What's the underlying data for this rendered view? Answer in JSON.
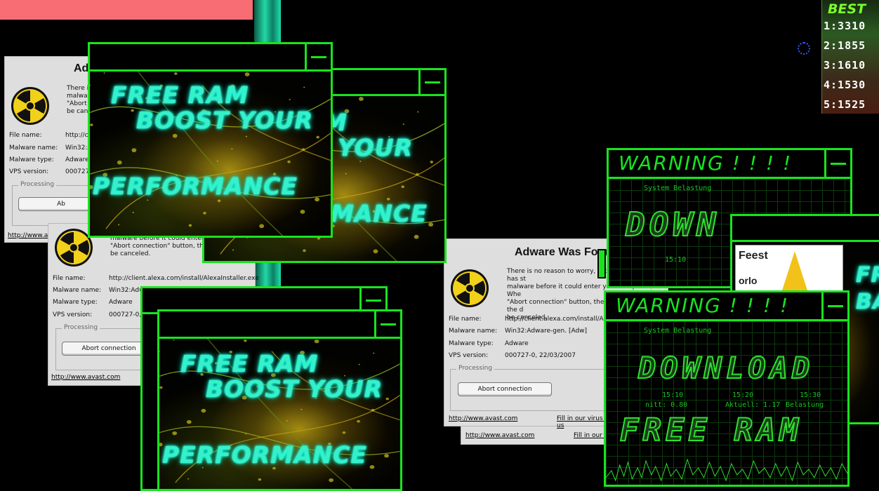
{
  "best": {
    "title": "BEST",
    "scores": [
      "1:3310",
      "2:1855",
      "3:1610",
      "4:1530",
      "5:1525"
    ]
  },
  "ad": {
    "line1": "FREE RAM",
    "line2": "BOOST YOUR",
    "line3": "PERFORMANCE",
    "partial_line1": "M",
    "partial_line2": "YOUR",
    "partial_line3": "MANCE"
  },
  "avast": {
    "title": "Adware Was Found!",
    "title_partial": "Ad",
    "message_lines": [
      "There is no reason to worry, though. avast! has st",
      "malware before it could enter your computer. Whe",
      "\"Abort connection\" button, the download of the d",
      "be canceled."
    ],
    "message_partial": [
      "There i",
      "malwa",
      "\"Abort",
      "be cance"
    ],
    "message_mid": [
      "malware before it could enter yo",
      "\"Abort connection\" button, the",
      "be canceled."
    ],
    "file_label": "File name:",
    "file_value": "http://client.alexa.com/install/AlexaInstaller.exe",
    "file_partial": "http://c",
    "malware_name_label": "Malware name:",
    "malware_name_value": "Win32:Adware-gen. [Adw]",
    "malware_name_partial": "Win32:A",
    "malware_type_label": "Malware type:",
    "malware_type_value": "Adware",
    "malware_type_partial": "Adware",
    "vps_label": "VPS version:",
    "vps_value": "000727-0, 22/03/2007",
    "vps_partial": "000727",
    "vps_mid": "000727-0, 22/0",
    "processing": "Processing",
    "abort_button": "Abort connection",
    "abort_partial": "Ab",
    "link": "http://www.avast.com",
    "link_partial": "http://www.a",
    "report": "Fill in our virus report to help us",
    "report_partial": "Fill in our v",
    "excl": "!"
  },
  "warning": {
    "title": "WARNING ! ! ! !",
    "system": "System Belastung",
    "times": [
      "15:10",
      "15:20",
      "15:30"
    ],
    "stats_avg": "nitt: 0.80",
    "stats_cur": "Aktuell: 1.17",
    "stats_load": "Belastung",
    "download": "DOWNLOAD",
    "download_partial": "DOWN",
    "free_ram": "FREE RAM"
  },
  "right_ad": {
    "line1": "FR",
    "line2": "BA",
    "sticker_line1": "Feest",
    "sticker_line2": "orlo"
  }
}
